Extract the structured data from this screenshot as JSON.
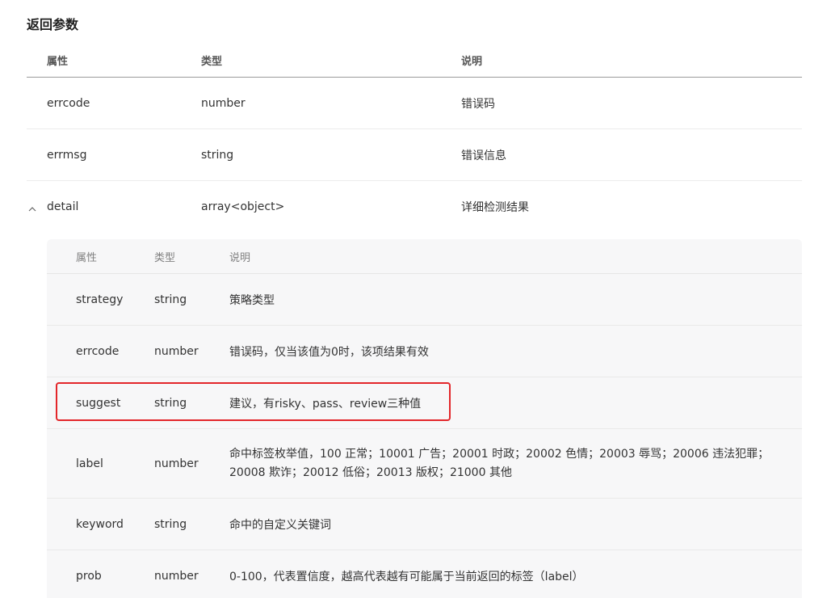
{
  "section": {
    "title": "返回参数"
  },
  "outer_table": {
    "headers": [
      "属性",
      "类型",
      "说明"
    ],
    "rows": [
      {
        "name": "errcode",
        "type": "number",
        "desc": "错误码"
      },
      {
        "name": "errmsg",
        "type": "string",
        "desc": "错误信息"
      },
      {
        "name": "detail",
        "type": "array<object>",
        "desc": "详细检测结果",
        "expanded": true
      }
    ]
  },
  "inner_table": {
    "headers": [
      "属性",
      "类型",
      "说明"
    ],
    "rows": [
      {
        "name": "strategy",
        "type": "string",
        "desc": "策略类型"
      },
      {
        "name": "errcode",
        "type": "number",
        "desc": "错误码，仅当该值为0时，该项结果有效"
      },
      {
        "name": "suggest",
        "type": "string",
        "desc": "建议，有risky、pass、review三种值"
      },
      {
        "name": "label",
        "type": "number",
        "desc": "命中标签枚举值，100 正常；10001 广告；20001 时政；20002 色情；20003 辱骂；20006 违法犯罪；20008 欺诈；20012 低俗；20013 版权；21000 其他"
      },
      {
        "name": "keyword",
        "type": "string",
        "desc": "命中的自定义关键词"
      },
      {
        "name": "prob",
        "type": "number",
        "desc": "0-100，代表置信度，越高代表越有可能属于当前返回的标签（label）"
      }
    ]
  },
  "colors": {
    "highlight": "#e3262a",
    "inner_background": "#f7f7f8"
  },
  "icons": {
    "expand": "chevron-up-icon"
  }
}
